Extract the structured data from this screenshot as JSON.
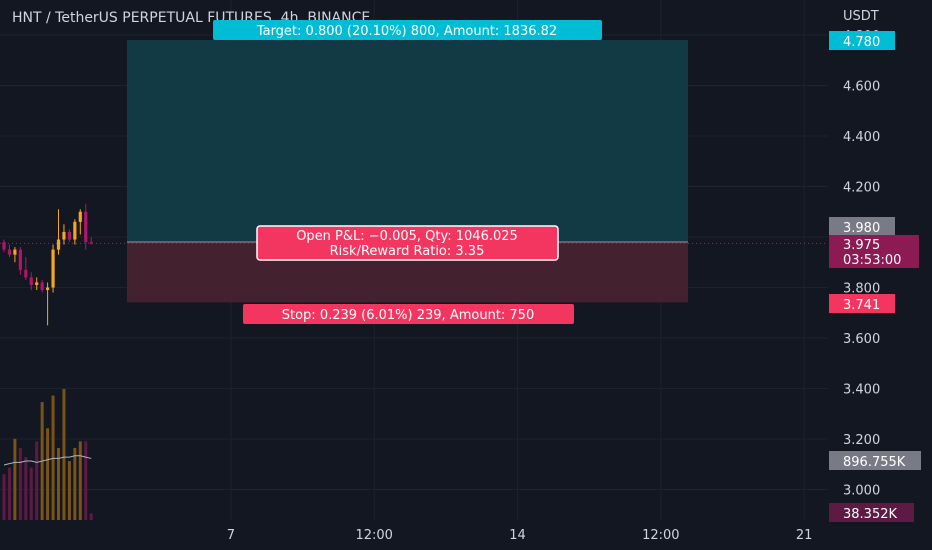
{
  "header": {
    "title": "HNT / TetherUS PERPETUAL FUTURES, 4h, BINANCE",
    "currency": "USDT"
  },
  "colors": {
    "background": "#131722",
    "grid": "#1e222d",
    "profit_zone": "#123a45",
    "loss_zone": "#43212f",
    "target_label": "#00bcd4",
    "stop_label": "#f23660",
    "up_candle": "#f5a623",
    "down_candle": "#b0166b",
    "volume_up": "#7a5317",
    "volume_down": "#5e1a44",
    "volume_ma": "#b2b5be",
    "price_tag": "#8c1a53",
    "entry_tag": "#787b86"
  },
  "position": {
    "target_label": "Target: 0.800 (20.10%) 800, Amount: 1836.82",
    "stop_label": "Stop: 0.239 (6.01%) 239, Amount: 750",
    "pnl_label": "Open P&L: −0.005, Qty: 1046.025",
    "rr_label": "Risk/Reward Ratio: 3.35",
    "target_price": 4.78,
    "entry_price": 3.98,
    "stop_price": 3.741
  },
  "price_tags": {
    "target": "4.780",
    "entry": "3.980",
    "last": "3.975",
    "countdown": "03:53:00",
    "stop": "3.741",
    "volume_ma": "896.755K",
    "volume": "38.352K"
  },
  "chart_data": {
    "type": "candlestick",
    "title": "HNT / TetherUS PERPETUAL FUTURES, 4h, BINANCE",
    "ylabel": "USDT",
    "ylim": [
      2.93,
      4.82
    ],
    "y_ticks": [
      "3.000",
      "3.200",
      "3.400",
      "3.600",
      "3.800",
      "4.000",
      "4.200",
      "4.400",
      "4.600",
      "4.800"
    ],
    "y_tick_values": [
      3.0,
      3.2,
      3.4,
      3.6,
      3.8,
      4.0,
      4.2,
      4.4,
      4.6,
      4.8
    ],
    "x_ticks": [
      "7",
      "12:00",
      "14",
      "12:00",
      "21"
    ],
    "x_tick_index": [
      38,
      62,
      86,
      110,
      134
    ],
    "x_index_range": [
      0,
      140
    ],
    "grid": true,
    "candles": [
      {
        "i": 0,
        "o": 3.98,
        "h": 3.99,
        "l": 3.94,
        "c": 3.95
      },
      {
        "i": 1,
        "o": 3.95,
        "h": 3.97,
        "l": 3.92,
        "c": 3.93
      },
      {
        "i": 2,
        "o": 3.93,
        "h": 3.96,
        "l": 3.9,
        "c": 3.95
      },
      {
        "i": 3,
        "o": 3.95,
        "h": 3.96,
        "l": 3.85,
        "c": 3.87
      },
      {
        "i": 4,
        "o": 3.87,
        "h": 3.92,
        "l": 3.83,
        "c": 3.84
      },
      {
        "i": 5,
        "o": 3.84,
        "h": 3.86,
        "l": 3.79,
        "c": 3.81
      },
      {
        "i": 6,
        "o": 3.81,
        "h": 3.84,
        "l": 3.79,
        "c": 3.82
      },
      {
        "i": 7,
        "o": 3.82,
        "h": 3.83,
        "l": 3.78,
        "c": 3.79
      },
      {
        "i": 8,
        "o": 3.79,
        "h": 3.82,
        "l": 3.65,
        "c": 3.8
      },
      {
        "i": 9,
        "o": 3.8,
        "h": 3.97,
        "l": 3.78,
        "c": 3.95
      },
      {
        "i": 10,
        "o": 3.95,
        "h": 4.11,
        "l": 3.93,
        "c": 3.99
      },
      {
        "i": 11,
        "o": 3.99,
        "h": 4.05,
        "l": 3.97,
        "c": 4.02
      },
      {
        "i": 12,
        "o": 4.02,
        "h": 4.03,
        "l": 3.98,
        "c": 3.99
      },
      {
        "i": 13,
        "o": 3.99,
        "h": 4.07,
        "l": 3.97,
        "c": 4.06
      },
      {
        "i": 14,
        "o": 4.06,
        "h": 4.11,
        "l": 4.01,
        "c": 4.1
      },
      {
        "i": 15,
        "o": 4.1,
        "h": 4.13,
        "l": 3.95,
        "c": 3.98
      },
      {
        "i": 16,
        "o": 3.98,
        "h": 4.0,
        "l": 3.97,
        "c": 3.975
      }
    ],
    "volume": [
      {
        "i": 0,
        "v": 0.35,
        "up": false
      },
      {
        "i": 1,
        "v": 0.4,
        "up": false
      },
      {
        "i": 2,
        "v": 0.62,
        "up": true
      },
      {
        "i": 3,
        "v": 0.55,
        "up": false
      },
      {
        "i": 4,
        "v": 0.48,
        "up": false
      },
      {
        "i": 5,
        "v": 0.4,
        "up": false
      },
      {
        "i": 6,
        "v": 0.6,
        "up": false
      },
      {
        "i": 7,
        "v": 0.9,
        "up": true
      },
      {
        "i": 8,
        "v": 0.7,
        "up": true
      },
      {
        "i": 9,
        "v": 0.95,
        "up": true
      },
      {
        "i": 10,
        "v": 0.55,
        "up": true
      },
      {
        "i": 11,
        "v": 1.0,
        "up": true
      },
      {
        "i": 12,
        "v": 0.45,
        "up": true
      },
      {
        "i": 13,
        "v": 0.55,
        "up": true
      },
      {
        "i": 14,
        "v": 0.6,
        "up": true
      },
      {
        "i": 15,
        "v": 0.6,
        "up": false
      },
      {
        "i": 16,
        "v": 0.05,
        "up": false
      }
    ],
    "volume_ma": [
      0.42,
      0.43,
      0.44,
      0.44,
      0.45,
      0.45,
      0.44,
      0.45,
      0.46,
      0.47,
      0.47,
      0.48,
      0.48,
      0.49,
      0.49,
      0.48,
      0.47
    ]
  }
}
